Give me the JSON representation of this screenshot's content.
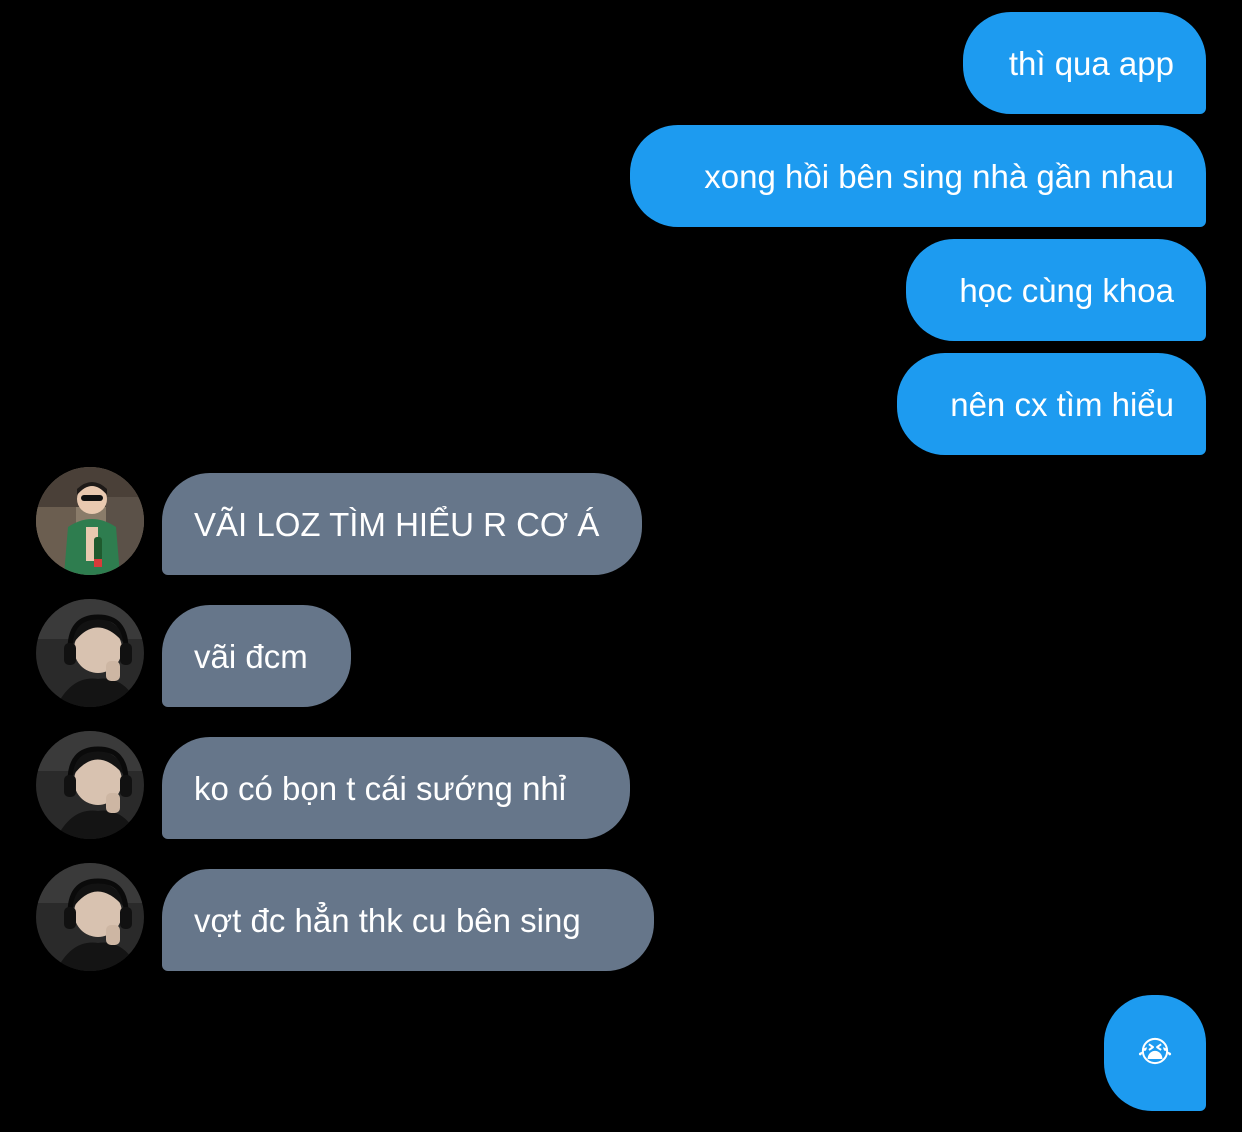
{
  "colors": {
    "background": "#000000",
    "sent_bubble": "#1d9bf0",
    "received_bubble": "#66768a",
    "text": "#ffffff"
  },
  "messages": [
    {
      "direction": "sent",
      "text": "thì qua app"
    },
    {
      "direction": "sent",
      "text": "xong hồi bên sing nhà gần nhau"
    },
    {
      "direction": "sent",
      "text": "học cùng khoa"
    },
    {
      "direction": "sent",
      "text": "nên cx tìm hiểu"
    },
    {
      "direction": "received",
      "avatar": "avatar-green-shirt-sunglasses",
      "text": "VÃI LOZ TÌM HIỂU R CƠ Á"
    },
    {
      "direction": "received",
      "avatar": "avatar-headphones",
      "text": "vãi đcm"
    },
    {
      "direction": "received",
      "avatar": "avatar-headphones",
      "text": "ko có bọn t cái sướng nhỉ"
    },
    {
      "direction": "received",
      "avatar": "avatar-headphones",
      "text": "vợt đc hẳn thk cu bên sing"
    },
    {
      "direction": "sent",
      "emoji": "loudly-crying-face-icon",
      "text": "😭"
    }
  ]
}
